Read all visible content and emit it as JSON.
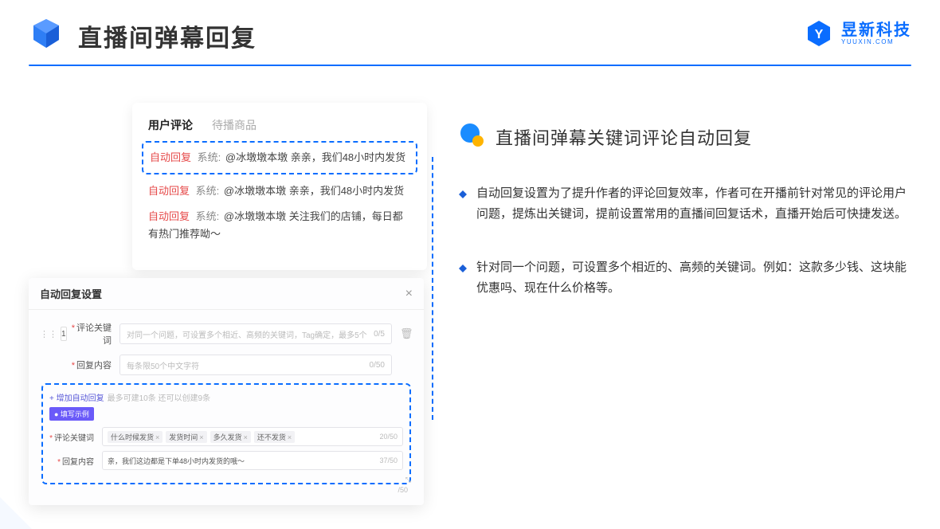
{
  "header": {
    "title": "直播间弹幕回复"
  },
  "brand": {
    "name": "昱新科技",
    "domain": "YUUXIN.COM"
  },
  "comments": {
    "tab_active": "用户评论",
    "tab_inactive": "待播商品",
    "row1_auto": "自动回复",
    "row1_sys": "系统:",
    "row1_text": "@冰墩墩本墩 亲亲，我们48小时内发货",
    "row2_auto": "自动回复",
    "row2_sys": "系统:",
    "row2_text": "@冰墩墩本墩 亲亲，我们48小时内发货",
    "row3_auto": "自动回复",
    "row3_sys": "系统:",
    "row3_text": "@冰墩墩本墩 关注我们的店铺，每日都有热门推荐呦～"
  },
  "settings": {
    "title": "自动回复设置",
    "index": "1",
    "label_keyword": "评论关键词",
    "placeholder_keyword": "对同一个问题，可设置多个相近、高频的关键词，Tag确定，最多5个",
    "count_keyword": "0/5",
    "label_content": "回复内容",
    "placeholder_content": "每条限50个中文字符",
    "count_content": "0/50",
    "add_link": "+ 增加自动回复",
    "add_hint": "最多可建10条 还可以创建9条",
    "example_badge": "● 填写示例",
    "ex_label_keyword": "评论关键词",
    "ex_tags": [
      "什么时候发货",
      "发货时间",
      "多久发货",
      "还不发货"
    ],
    "ex_count_keyword": "20/50",
    "ex_label_content": "回复内容",
    "ex_content_value": "亲，我们这边都是下单48小时内发货的哦～",
    "ex_count_content": "37/50",
    "outside_count": "/50"
  },
  "right": {
    "section_title": "直播间弹幕关键词评论自动回复",
    "p1": "自动回复设置为了提升作者的评论回复效率，作者可在开播前针对常见的评论用户问题，提炼出关键词，提前设置常用的直播间回复话术，直播开始后可快捷发送。",
    "p2": "针对同一个问题，可设置多个相近的、高频的关键词。例如：这款多少钱、这块能优惠吗、现在什么价格等。"
  }
}
